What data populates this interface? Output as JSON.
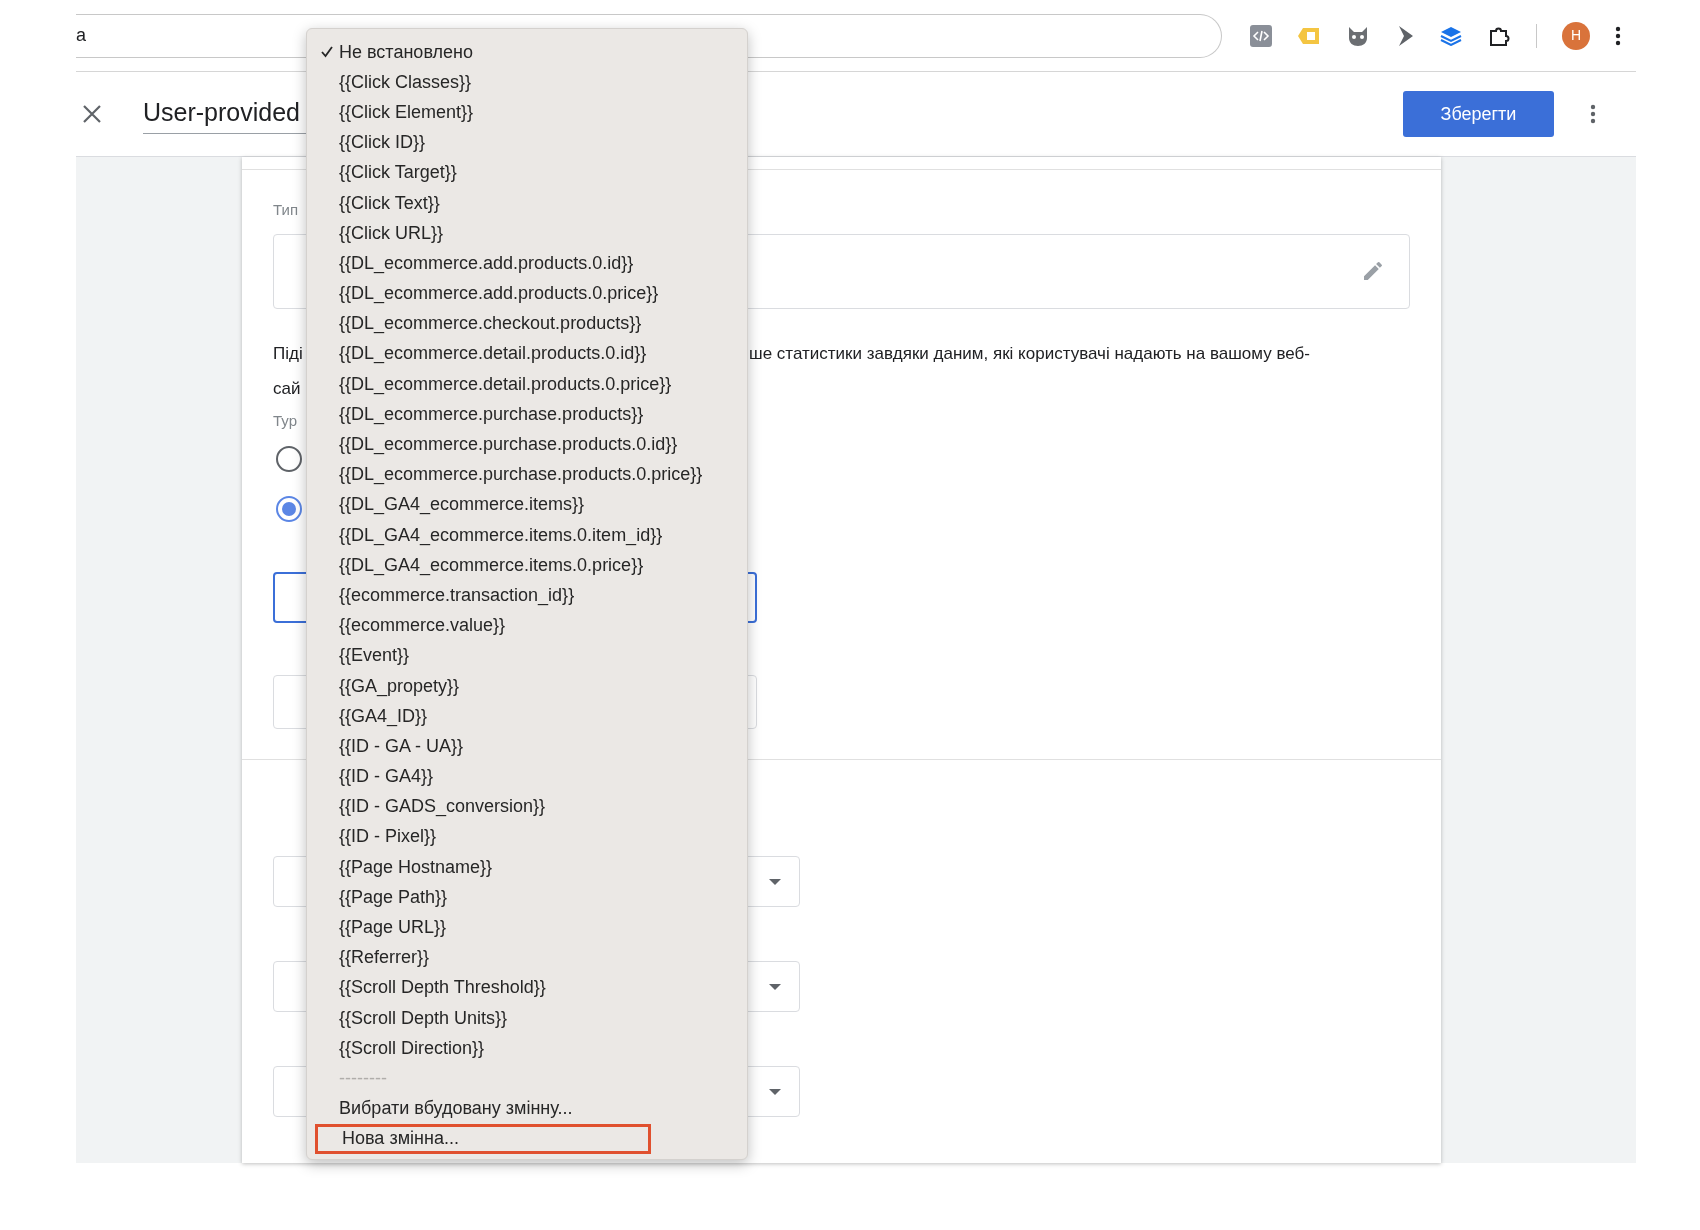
{
  "browser": {
    "address": "a",
    "avatar": "H"
  },
  "header": {
    "title": "User-provided",
    "save_button": "Зберегти"
  },
  "form": {
    "type_label": "Тип",
    "description_fragments": [
      "Піді",
      "сай",
      "ше статистики завдяки даним, які користувачі надають на вашому веб-"
    ],
    "type_label_2": "Typ",
    "radios": [
      {
        "selected": false
      },
      {
        "selected": true
      }
    ]
  },
  "menu": {
    "items": [
      {
        "kind": "option",
        "label": "Не встановлено",
        "selected": true
      },
      {
        "kind": "option",
        "label": "{{Click Classes}}",
        "selected": false
      },
      {
        "kind": "option",
        "label": "{{Click Element}}",
        "selected": false
      },
      {
        "kind": "option",
        "label": "{{Click ID}}",
        "selected": false
      },
      {
        "kind": "option",
        "label": "{{Click Target}}",
        "selected": false
      },
      {
        "kind": "option",
        "label": "{{Click Text}}",
        "selected": false
      },
      {
        "kind": "option",
        "label": "{{Click URL}}",
        "selected": false
      },
      {
        "kind": "option",
        "label": "{{DL_ecommerce.add.products.0.id}}",
        "selected": false
      },
      {
        "kind": "option",
        "label": "{{DL_ecommerce.add.products.0.price}}",
        "selected": false
      },
      {
        "kind": "option",
        "label": "{{DL_ecommerce.checkout.products}}",
        "selected": false
      },
      {
        "kind": "option",
        "label": "{{DL_ecommerce.detail.products.0.id}}",
        "selected": false
      },
      {
        "kind": "option",
        "label": "{{DL_ecommerce.detail.products.0.price}}",
        "selected": false
      },
      {
        "kind": "option",
        "label": "{{DL_ecommerce.purchase.products}}",
        "selected": false
      },
      {
        "kind": "option",
        "label": "{{DL_ecommerce.purchase.products.0.id}}",
        "selected": false
      },
      {
        "kind": "option",
        "label": "{{DL_ecommerce.purchase.products.0.price}}",
        "selected": false
      },
      {
        "kind": "option",
        "label": "{{DL_GA4_ecommerce.items}}",
        "selected": false
      },
      {
        "kind": "option",
        "label": "{{DL_GA4_ecommerce.items.0.item_id}}",
        "selected": false
      },
      {
        "kind": "option",
        "label": "{{DL_GA4_ecommerce.items.0.price}}",
        "selected": false
      },
      {
        "kind": "option",
        "label": "{{ecommerce.transaction_id}}",
        "selected": false
      },
      {
        "kind": "option",
        "label": "{{ecommerce.value}}",
        "selected": false
      },
      {
        "kind": "option",
        "label": "{{Event}}",
        "selected": false
      },
      {
        "kind": "option",
        "label": "{{GA_propety}}",
        "selected": false
      },
      {
        "kind": "option",
        "label": "{{GA4_ID}}",
        "selected": false
      },
      {
        "kind": "option",
        "label": "{{ID - GA - UA}}",
        "selected": false
      },
      {
        "kind": "option",
        "label": "{{ID - GA4}}",
        "selected": false
      },
      {
        "kind": "option",
        "label": "{{ID - GADS_conversion}}",
        "selected": false
      },
      {
        "kind": "option",
        "label": "{{ID - Pixel}}",
        "selected": false
      },
      {
        "kind": "option",
        "label": "{{Page Hostname}}",
        "selected": false
      },
      {
        "kind": "option",
        "label": "{{Page Path}}",
        "selected": false
      },
      {
        "kind": "option",
        "label": "{{Page URL}}",
        "selected": false
      },
      {
        "kind": "option",
        "label": "{{Referrer}}",
        "selected": false
      },
      {
        "kind": "option",
        "label": "{{Scroll Depth Threshold}}",
        "selected": false
      },
      {
        "kind": "option",
        "label": "{{Scroll Depth Units}}",
        "selected": false
      },
      {
        "kind": "option",
        "label": "{{Scroll Direction}}",
        "selected": false
      },
      {
        "kind": "separator",
        "label": "--------"
      },
      {
        "kind": "action",
        "label": "Вибрати вбудовану змінну...",
        "highlighted": false
      },
      {
        "kind": "action",
        "label": "Нова змінна...",
        "highlighted": true
      }
    ]
  }
}
